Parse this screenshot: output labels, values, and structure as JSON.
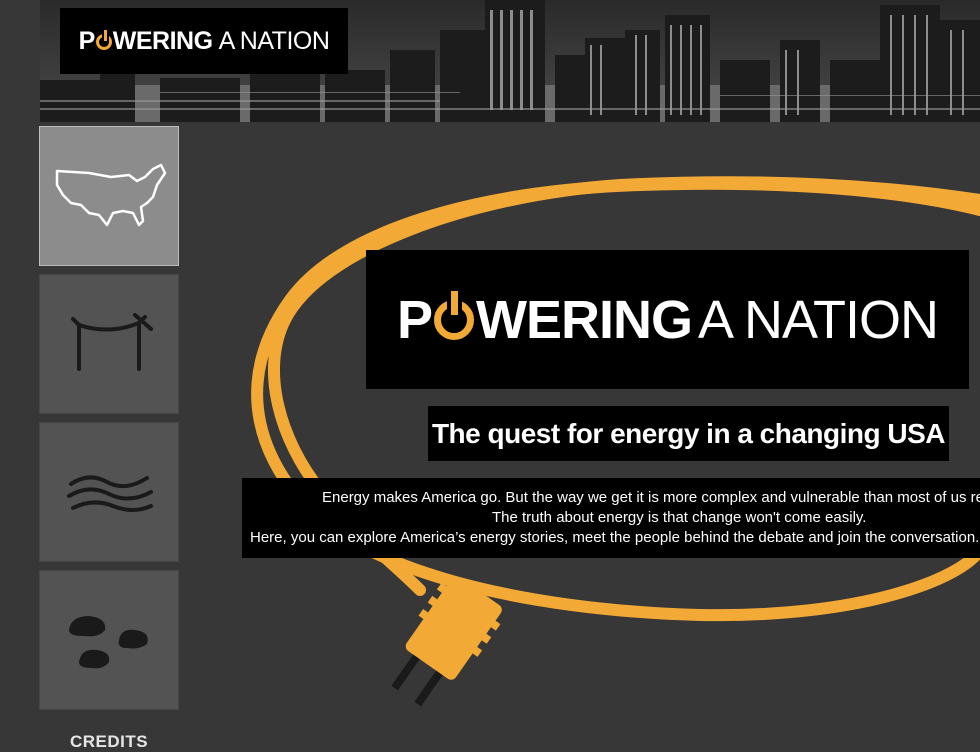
{
  "header": {
    "logo": {
      "word1_part1": "P",
      "word1_part2": "WERING",
      "word2": "A NATION"
    }
  },
  "sidebar": {
    "tiles": [
      {
        "icon": "usa-map-icon"
      },
      {
        "icon": "power-line-icon"
      },
      {
        "icon": "wind-waves-icon"
      },
      {
        "icon": "rocks-icon"
      }
    ],
    "credits_label": "CREDITS"
  },
  "main": {
    "logo": {
      "word1_part1": "P",
      "word1_part2": "WERING",
      "word2": "A NATION"
    },
    "tagline": "The quest for energy in a changing USA",
    "intro_lines": [
      "Energy makes America go. But the way we get it is more complex and vulnerable than most of us realize.",
      "The truth about energy is that change won't come easily.",
      "Here, you can explore America’s energy stories, meet the people behind the debate and join the conversation."
    ]
  },
  "colors": {
    "accent": "#f3a935",
    "background": "#373737",
    "panel": "#000000"
  }
}
